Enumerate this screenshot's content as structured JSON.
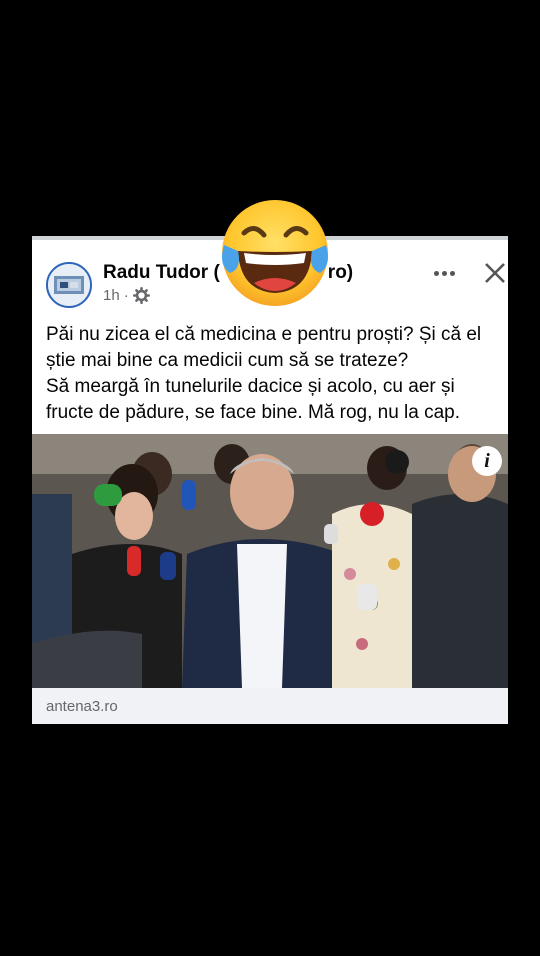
{
  "post": {
    "author": "Radu Tudor (",
    "author_suffix": "ro)",
    "time": "1h",
    "separator": "·",
    "text_lines": [
      "Păi nu zicea el că medicina e pentru proști? Și că el știe mai bine ca medicii cum să se trateze?",
      "Să meargă în tunelurile dacice și acolo, cu aer și fructe de pădure, se face bine. Mă rog, nu la cap."
    ]
  },
  "link": {
    "domain": "antena3.ro"
  },
  "icons": {
    "overlay": "laughing-tears-emoji",
    "more": "more-options-icon",
    "close": "close-icon",
    "audience": "gear-icon",
    "info": "info-icon"
  },
  "colors": {
    "background": "#000000",
    "card": "#ffffff",
    "link_bar": "#f0f2f5",
    "secondary_text": "#65676b"
  }
}
